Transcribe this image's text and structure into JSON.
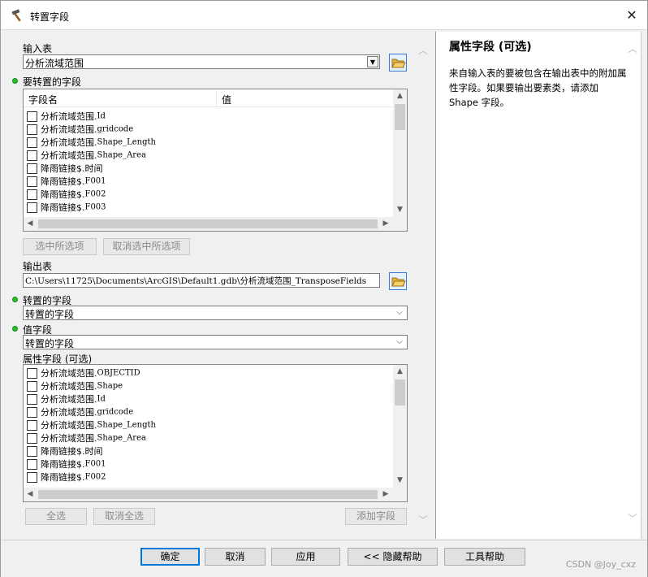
{
  "window": {
    "title": "转置字段",
    "close_label": "✕"
  },
  "input_table": {
    "label": "输入表",
    "value": "分析流域范围"
  },
  "fields_to_transpose": {
    "label": "要转置的字段",
    "columns": [
      "字段名",
      "值"
    ],
    "rows": [
      {
        "prefix": "分析流域范围.",
        "name": "Id"
      },
      {
        "prefix": "分析流域范围.",
        "name": "gridcode"
      },
      {
        "prefix": "分析流域范围.",
        "name": "Shape_Length"
      },
      {
        "prefix": "分析流域范围.",
        "name": "Shape_Area"
      },
      {
        "prefix": "降雨链接$.",
        "name": "时间"
      },
      {
        "prefix": "降雨链接$.",
        "name": "F001"
      },
      {
        "prefix": "降雨链接$.",
        "name": "F002"
      },
      {
        "prefix": "降雨链接$.",
        "name": "F003"
      }
    ],
    "select_all_label": "选中所选项",
    "unselect_all_label": "取消选中所选项"
  },
  "output_table": {
    "label": "输出表",
    "value": "C:\\Users\\11725\\Documents\\ArcGIS\\Default1.gdb\\分析流域范围_TransposeFields"
  },
  "transposed_field": {
    "label": "转置的字段",
    "value": "转置的字段"
  },
  "value_field": {
    "label": "值字段",
    "value": "转置的字段"
  },
  "attribute_fields": {
    "label": "属性字段 (可选)",
    "rows": [
      {
        "prefix": "分析流域范围.",
        "name": "OBJECTID"
      },
      {
        "prefix": "分析流域范围.",
        "name": "Shape"
      },
      {
        "prefix": "分析流域范围.",
        "name": "Id"
      },
      {
        "prefix": "分析流域范围.",
        "name": "gridcode"
      },
      {
        "prefix": "分析流域范围.",
        "name": "Shape_Length"
      },
      {
        "prefix": "分析流域范围.",
        "name": "Shape_Area"
      },
      {
        "prefix": "降雨链接$.",
        "name": "时间"
      },
      {
        "prefix": "降雨链接$.",
        "name": "F001"
      },
      {
        "prefix": "降雨链接$.",
        "name": "F002"
      }
    ],
    "select_all_label": "全选",
    "unselect_all_label": "取消全选",
    "add_field_label": "添加字段"
  },
  "help": {
    "title": "属性字段 (可选)",
    "body": "来自输入表的要被包含在输出表中的附加属性字段。如果要输出要素类，请添加 Shape 字段。"
  },
  "buttons": {
    "ok": "确定",
    "cancel": "取消",
    "apply": "应用",
    "hide_help": "<< 隐藏帮助",
    "tool_help": "工具帮助"
  },
  "watermark": "CSDN @Joy_cxz",
  "colors": {
    "accent": "#0078d7",
    "required_dot": "#25c225"
  }
}
